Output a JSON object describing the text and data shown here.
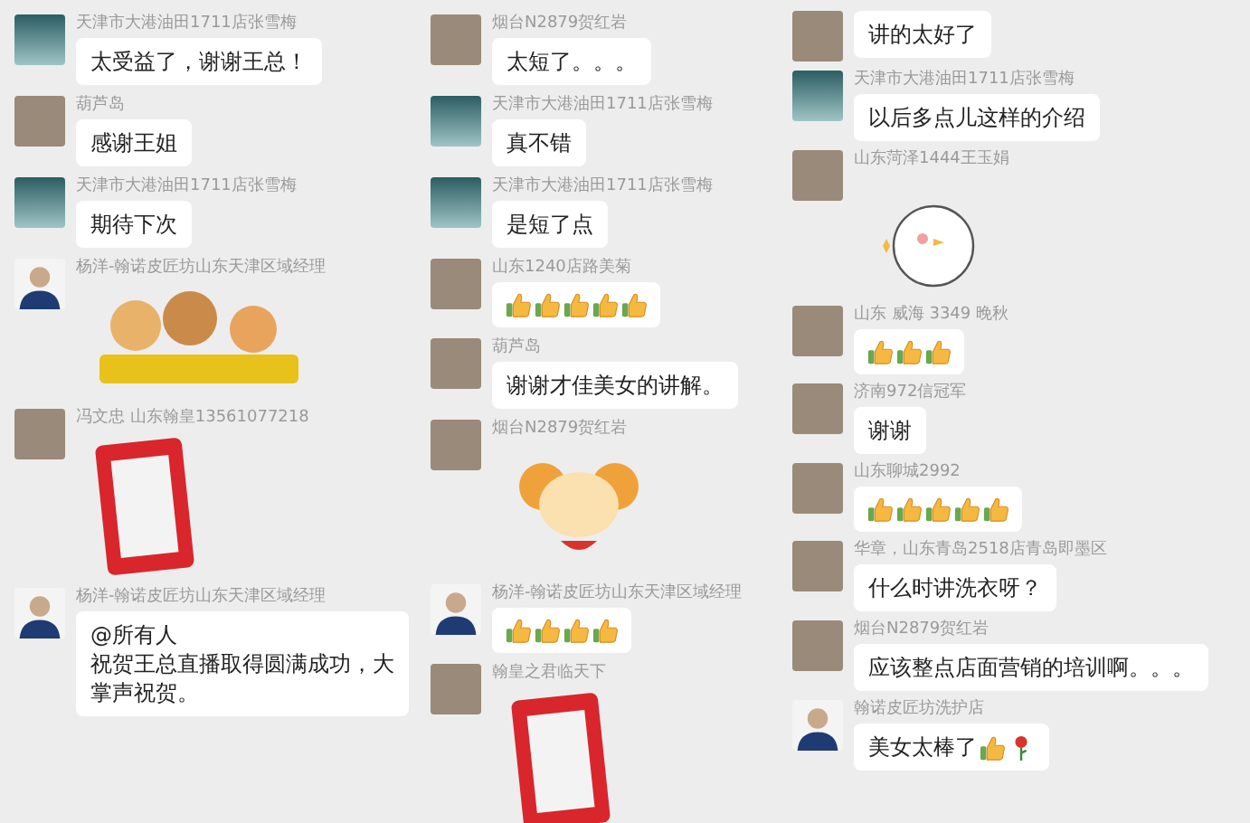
{
  "panels": [
    {
      "messages": [
        {
          "sender": "天津市大港油田1711店张雪梅",
          "avatar": {
            "kind": "swan"
          },
          "kind": "text",
          "text": "太受益了，谢谢王总！"
        },
        {
          "sender": "葫芦岛",
          "avatar": {
            "kind": "photo"
          },
          "kind": "text",
          "text": "感谢王姐"
        },
        {
          "sender": "天津市大港油田1711店张雪梅",
          "avatar": {
            "kind": "swan"
          },
          "kind": "text",
          "text": "期待下次"
        },
        {
          "sender": "杨洋-翰诺皮匠坊山东天津区域经理",
          "avatar": {
            "kind": "person"
          },
          "kind": "sticker",
          "sticker": {
            "kind": "mascots"
          }
        },
        {
          "sender": "冯文忠  山东翰皇13561077218",
          "avatar": {
            "kind": "photo"
          },
          "kind": "sticker",
          "sticker": {
            "kind": "stamp"
          }
        },
        {
          "sender": "杨洋-翰诺皮匠坊山东天津区域经理",
          "avatar": {
            "kind": "person"
          },
          "kind": "text",
          "mention": "@所有人",
          "text": "祝贺王总直播取得圆满成功，大掌声祝贺。"
        }
      ]
    },
    {
      "messages": [
        {
          "sender": "烟台N2879贺红岩",
          "avatar": {
            "kind": "photo"
          },
          "kind": "text",
          "text": "太短了。。。"
        },
        {
          "sender": "天津市大港油田1711店张雪梅",
          "avatar": {
            "kind": "swan"
          },
          "kind": "text",
          "text": "真不错"
        },
        {
          "sender": "天津市大港油田1711店张雪梅",
          "avatar": {
            "kind": "swan"
          },
          "kind": "text",
          "text": "是短了点"
        },
        {
          "sender": "山东1240店路美菊",
          "avatar": {
            "kind": "photo"
          },
          "kind": "emoji",
          "emojis": [
            {
              "kind": "thumbs-up"
            },
            {
              "kind": "thumbs-up"
            },
            {
              "kind": "thumbs-up"
            },
            {
              "kind": "thumbs-up"
            },
            {
              "kind": "thumbs-up"
            }
          ]
        },
        {
          "sender": "葫芦岛",
          "avatar": {
            "kind": "photo"
          },
          "kind": "text",
          "text": "谢谢才佳美女的讲解。"
        },
        {
          "sender": "烟台N2879贺红岩",
          "avatar": {
            "kind": "photo"
          },
          "kind": "sticker",
          "sticker": {
            "kind": "mouse"
          }
        },
        {
          "sender": "杨洋-翰诺皮匠坊山东天津区域经理",
          "avatar": {
            "kind": "person"
          },
          "kind": "emoji",
          "emojis": [
            {
              "kind": "thumbs-up"
            },
            {
              "kind": "thumbs-up"
            },
            {
              "kind": "thumbs-up"
            },
            {
              "kind": "thumbs-up"
            }
          ]
        },
        {
          "sender": "翰皇之君临天下",
          "avatar": {
            "kind": "photo"
          },
          "kind": "sticker",
          "sticker": {
            "kind": "stamp"
          }
        }
      ]
    },
    {
      "messages": [
        {
          "avatar": {
            "kind": "photo"
          },
          "kind": "text",
          "text": "讲的太好了"
        },
        {
          "sender": "天津市大港油田1711店张雪梅",
          "avatar": {
            "kind": "swan"
          },
          "kind": "text",
          "text": "以后多点儿这样的介绍"
        },
        {
          "sender": "山东菏泽1444王玉娟",
          "avatar": {
            "kind": "photo"
          },
          "kind": "sticker",
          "sticker": {
            "kind": "chick"
          }
        },
        {
          "sender": "山东 威海 3349 晚秋",
          "avatar": {
            "kind": "photo"
          },
          "kind": "emoji",
          "emojis": [
            {
              "kind": "thumbs-up"
            },
            {
              "kind": "thumbs-up"
            },
            {
              "kind": "thumbs-up"
            }
          ]
        },
        {
          "sender": "济南972信冠军",
          "avatar": {
            "kind": "photo"
          },
          "kind": "text",
          "text": "谢谢"
        },
        {
          "sender": "山东聊城2992",
          "avatar": {
            "kind": "photo"
          },
          "kind": "emoji",
          "emojis": [
            {
              "kind": "thumbs-up"
            },
            {
              "kind": "thumbs-up"
            },
            {
              "kind": "thumbs-up"
            },
            {
              "kind": "thumbs-up"
            },
            {
              "kind": "thumbs-up"
            }
          ]
        },
        {
          "sender": "华章，山东青岛2518店青岛即墨区",
          "avatar": {
            "kind": "photo"
          },
          "kind": "text",
          "text": "什么时讲洗衣呀？"
        },
        {
          "sender": "烟台N2879贺红岩",
          "avatar": {
            "kind": "photo"
          },
          "kind": "text",
          "text": "应该整点店面营销的培训啊。。。"
        },
        {
          "sender": "翰诺皮匠坊洗护店",
          "avatar": {
            "kind": "person"
          },
          "kind": "text",
          "text": "美女太棒了",
          "emojis": [
            {
              "kind": "thumbs-up"
            },
            {
              "kind": "rose"
            }
          ]
        }
      ]
    }
  ]
}
